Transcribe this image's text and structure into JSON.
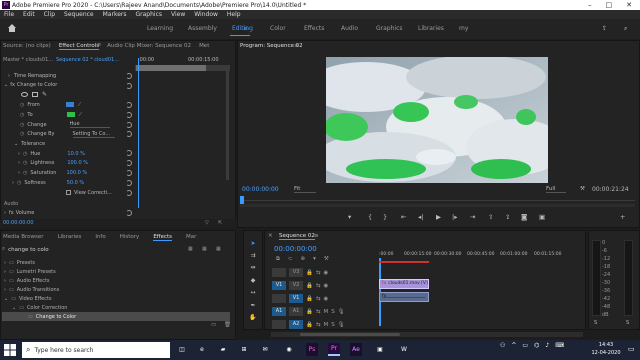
{
  "window": {
    "title": "Adobe Premiere Pro 2020 - C:\\Users\\Rajeev Anand\\Documents\\Adobe\\Premiere Pro\\14.0\\Untitled *",
    "app_icon": "Pr",
    "minimize": "–",
    "maximize": "□",
    "close": "✕"
  },
  "menu": [
    "File",
    "Edit",
    "Clip",
    "Sequence",
    "Markers",
    "Graphics",
    "View",
    "Window",
    "Help"
  ],
  "workspaces": [
    "Learning",
    "Assembly",
    "Editing",
    "Color",
    "Effects",
    "Audio",
    "Graphics",
    "Libraries",
    "my"
  ],
  "active_workspace": "Editing",
  "source_panel": {
    "tabs": [
      "Source: (no clips)",
      "Effect Controls",
      "Audio Clip Mixer: Sequence 02",
      "Met"
    ],
    "active": "Effect Controls",
    "menu_icon": "≡"
  },
  "effect_controls": {
    "master": "Master * clouds01...",
    "clip": "Sequence 02 * cloud01...",
    "time_start": ":00:00",
    "time_mid": "00:00:15:00",
    "rows": [
      {
        "indent": 0,
        "label": "Time Remapping",
        "value": ""
      },
      {
        "indent": 0,
        "fx": "fx",
        "label": "Change to Color",
        "value": ""
      },
      {
        "indent": 1,
        "label": "From",
        "value": ""
      },
      {
        "indent": 1,
        "label": "To",
        "value": ""
      },
      {
        "indent": 1,
        "label": "Change",
        "value": "Hue"
      },
      {
        "indent": 1,
        "label": "Change By",
        "value": "Setting To Co..."
      },
      {
        "indent": 1,
        "label": "Tolerance",
        "value": ""
      },
      {
        "indent": 2,
        "label": "Hue",
        "value": "10.0 %"
      },
      {
        "indent": 2,
        "label": "Lightness",
        "value": "100.0 %"
      },
      {
        "indent": 2,
        "label": "Saturation",
        "value": "100.0 %"
      },
      {
        "indent": 1,
        "label": "Softness",
        "value": "50.0 %"
      },
      {
        "indent": 1,
        "label": "View Correcti...",
        "value": ""
      }
    ],
    "from_color": "#3b7fd0",
    "to_color": "#2fc04a",
    "audio_section": "Audio",
    "volume": "Volume",
    "footer_time": "00:00:00:00"
  },
  "effects_panel": {
    "tabs": [
      "Media Browser",
      "Libraries",
      "Info",
      "History",
      "Effects",
      "Mar"
    ],
    "active": "Effects",
    "search": "change to colo",
    "tree": [
      {
        "label": "Presets",
        "indent": 0
      },
      {
        "label": "Lumetri Presets",
        "indent": 0
      },
      {
        "label": "Audio Effects",
        "indent": 0
      },
      {
        "label": "Audio Transitions",
        "indent": 0
      },
      {
        "label": "Video Effects",
        "indent": 0
      },
      {
        "label": "Color Correction",
        "indent": 1
      },
      {
        "label": "Change to Color",
        "indent": 2
      }
    ],
    "selected_item": "Change to Color"
  },
  "program_monitor": {
    "title": "Program: Sequence 02",
    "timecode": "00:00:00:00",
    "fit": "Fit",
    "quality": "Full",
    "duration": "00:00:21:24"
  },
  "timeline": {
    "title": "Sequence 02",
    "timecode": "00:00:00:00",
    "ruler": [
      ":00:00",
      "00:00:15:00",
      "00:00:30:00",
      "00:00:45:00",
      "00:01:00:00",
      "00:01:15:00"
    ],
    "tracks": [
      {
        "source": "",
        "name": "V3",
        "type": "video"
      },
      {
        "source": "V1",
        "name": "V2",
        "type": "video"
      },
      {
        "source": "",
        "name": "V1",
        "type": "video"
      },
      {
        "source": "A1",
        "name": "A1",
        "type": "audio"
      },
      {
        "source": "",
        "name": "A2",
        "type": "audio"
      }
    ],
    "video_clip": "clouds01.mov [V]",
    "audio_clip_icon": "fx"
  },
  "audio_meter": {
    "scale": [
      "0",
      "-6",
      "-12",
      "-18",
      "-24",
      "-30",
      "-36",
      "-42",
      "-48",
      "dB"
    ],
    "left_label": "S",
    "right_label": "S"
  },
  "taskbar": {
    "search_placeholder": "Type here to search",
    "time": "14:43",
    "date": "12-04-2020"
  }
}
